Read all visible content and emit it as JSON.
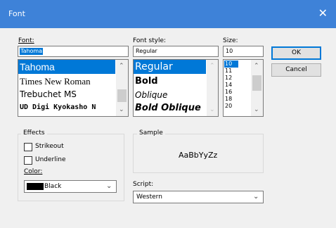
{
  "window": {
    "title": "Font"
  },
  "font": {
    "label": "Font:",
    "value": "Tahoma",
    "items": [
      "Tahoma",
      "Times New Roman",
      "Trebuchet MS",
      "UD Digi Kyokasho N"
    ]
  },
  "style": {
    "label": "Font style:",
    "value": "Regular",
    "items": [
      "Regular",
      "Bold",
      "Oblique",
      "Bold Oblique"
    ]
  },
  "size": {
    "label": "Size:",
    "value": "10",
    "items": [
      "10",
      "11",
      "12",
      "14",
      "16",
      "18",
      "20"
    ]
  },
  "buttons": {
    "ok": "OK",
    "cancel": "Cancel"
  },
  "effects": {
    "label": "Effects",
    "strikeout": "Strikeout",
    "underline": "Underline",
    "color_label": "Color:",
    "color_value": "Black",
    "color_hex": "#000000"
  },
  "sample": {
    "label": "Sample",
    "text": "AaBbYyZz"
  },
  "script": {
    "label": "Script:",
    "value": "Western"
  },
  "colors": {
    "titlebar": "#3e82d8",
    "selection": "#0078d7"
  },
  "icons": {
    "close": "close-icon",
    "scroll_up": "chevron-up-icon",
    "scroll_down": "chevron-down-icon"
  }
}
